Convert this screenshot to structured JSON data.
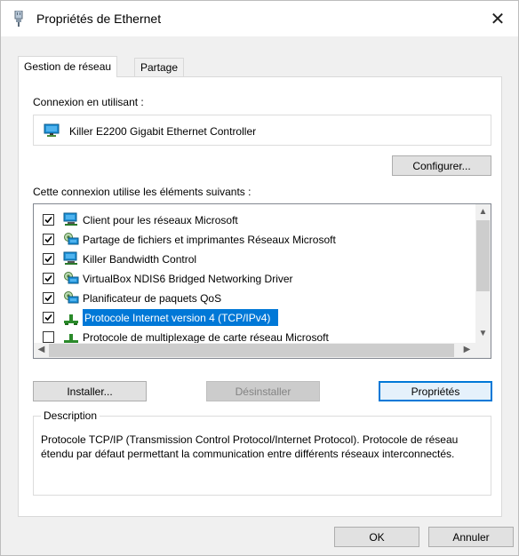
{
  "window": {
    "title": "Propriétés de Ethernet",
    "close_glyph": "✕"
  },
  "tabs": [
    {
      "label": "Gestion de réseau",
      "active": true
    },
    {
      "label": "Partage",
      "active": false
    }
  ],
  "connection": {
    "label": "Connexion en utilisant :",
    "adapter": "Killer E2200 Gigabit Ethernet Controller",
    "configure_button": "Configurer..."
  },
  "components": {
    "label": "Cette connexion utilise les éléments suivants :",
    "items": [
      {
        "label": "Client pour les réseaux Microsoft",
        "checked": true,
        "icon": "network-client-icon"
      },
      {
        "label": "Partage de fichiers et imprimantes Réseaux Microsoft",
        "checked": true,
        "icon": "service-icon"
      },
      {
        "label": "Killer Bandwidth Control",
        "checked": true,
        "icon": "network-client-icon"
      },
      {
        "label": "VirtualBox NDIS6 Bridged Networking Driver",
        "checked": true,
        "icon": "service-icon"
      },
      {
        "label": "Planificateur de paquets QoS",
        "checked": true,
        "icon": "service-icon"
      },
      {
        "label": "Protocole Internet version 4 (TCP/IPv4)",
        "checked": true,
        "icon": "protocol-icon",
        "selected": true
      },
      {
        "label": "Protocole de multiplexage de carte réseau Microsoft",
        "checked": false,
        "icon": "protocol-icon"
      }
    ]
  },
  "actions": {
    "install": "Installer...",
    "uninstall": "Désinstaller",
    "properties": "Propriétés"
  },
  "description": {
    "legend": "Description",
    "text": "Protocole TCP/IP (Transmission Control Protocol/Internet Protocol). Protocole de réseau étendu par défaut permettant la communication entre différents réseaux interconnectés."
  },
  "footer": {
    "ok": "OK",
    "cancel": "Annuler"
  },
  "colors": {
    "selection": "#0078d7",
    "focus_border": "#0078d7"
  }
}
